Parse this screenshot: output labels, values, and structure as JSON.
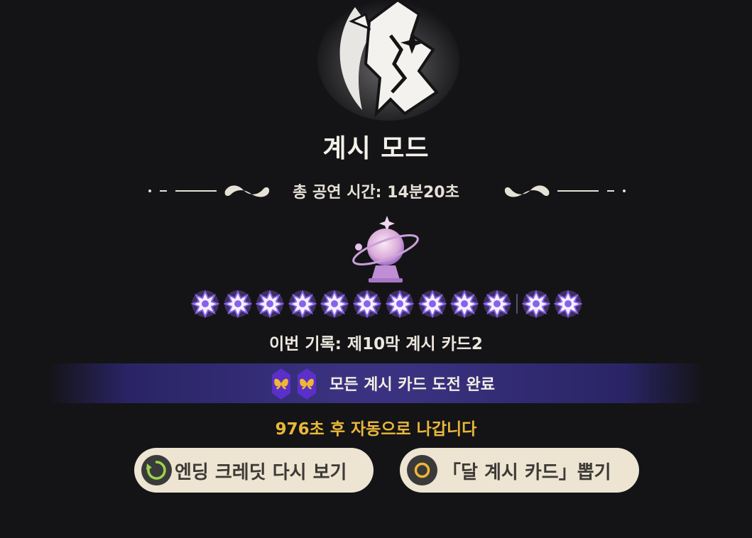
{
  "mode": {
    "title": "계시 모드"
  },
  "summary": {
    "total_time": "총 공연 시간: 14분20초"
  },
  "stars": {
    "earned": 12,
    "total": 12
  },
  "record": {
    "text": "이번 기록: 제10막 계시 카드2"
  },
  "banner": {
    "text": "모든 계시 카드 도전 완료",
    "icon": "butterfly-gem-icon"
  },
  "countdown": {
    "text": "976초 후 자동으로 나갑니다"
  },
  "buttons": {
    "credits": {
      "label": "엔딩 크레딧 다시 보기",
      "icon": "replay-icon"
    },
    "draw": {
      "label": "「달 계시 카드」뽑기",
      "icon": "circle-button-icon"
    }
  },
  "colors": {
    "accent_gold": "#e9b73b",
    "banner_purple": "#3a3280",
    "star_purple": "#8a62e8",
    "button_bg": "#ede4d2"
  }
}
